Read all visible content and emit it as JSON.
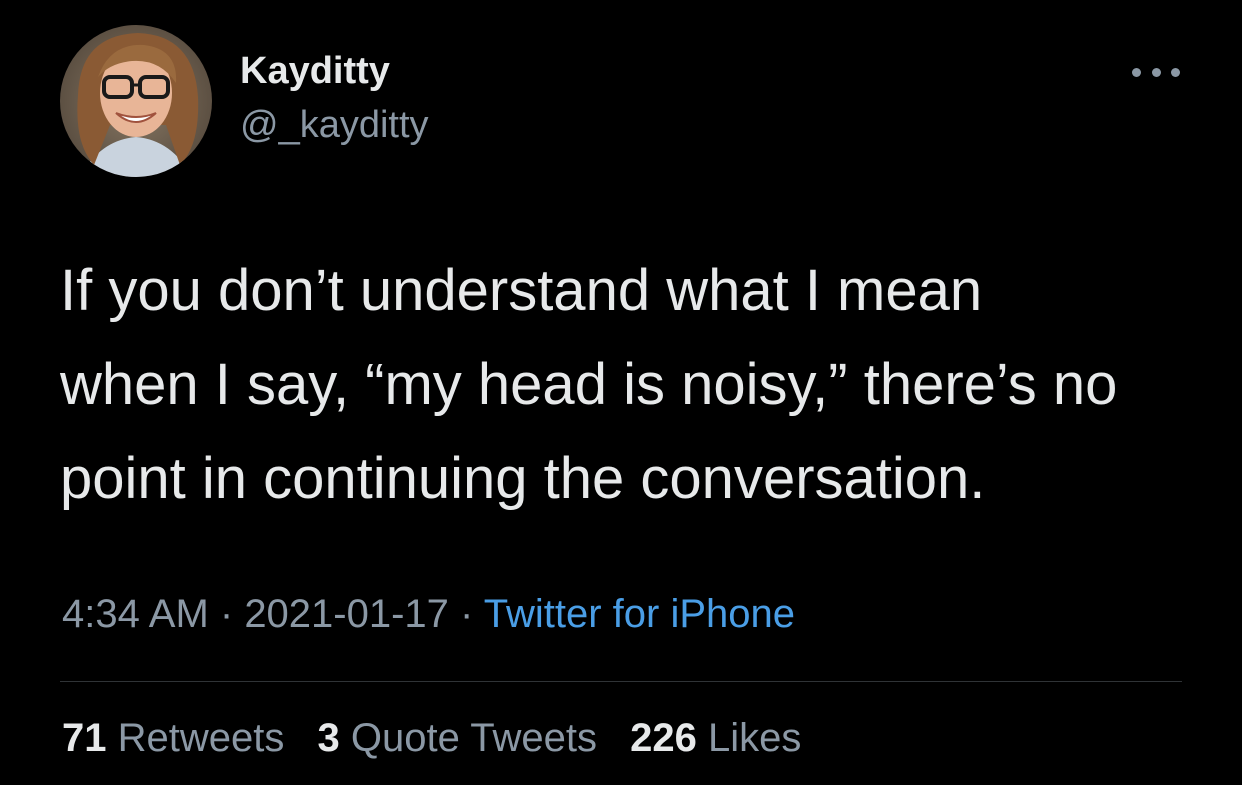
{
  "user": {
    "display_name": "Kayditty",
    "handle": "@_kayditty"
  },
  "tweet": {
    "lines": [
      "If you don’t understand what I mean",
      "when I say, “my head is noisy,” there’s no",
      "point in continuing the conversation."
    ],
    "time": "4:34 AM",
    "separator": " · ",
    "date": "2021-01-17",
    "source": "Twitter for iPhone"
  },
  "stats": {
    "retweets_count": "71",
    "retweets_label": "Retweets",
    "quotes_count": "3",
    "quotes_label": "Quote Tweets",
    "likes_count": "226",
    "likes_label": "Likes"
  },
  "icons": {
    "more": "more-horizontal-icon"
  },
  "colors": {
    "background": "#000000",
    "primary_text": "#e7e9ea",
    "secondary_text": "#8b98a5",
    "link": "#4a9ee6",
    "divider": "#2f3336"
  }
}
